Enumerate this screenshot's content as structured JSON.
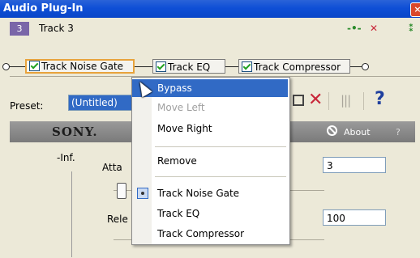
{
  "window": {
    "title": "Audio Plug-In",
    "close_label": "×"
  },
  "track": {
    "number": "3",
    "name": "Track 3"
  },
  "chain": {
    "plugins": [
      {
        "label": "Track Noise Gate",
        "checked": true,
        "active": true
      },
      {
        "label": "Track EQ",
        "checked": true,
        "active": false
      },
      {
        "label": "Track Compressor",
        "checked": true,
        "active": false
      }
    ]
  },
  "preset": {
    "label": "Preset:",
    "value": "(Untitled)"
  },
  "toolbar": {
    "delete_glyph": "✕",
    "bars_glyph": "|||",
    "help_glyph": "?"
  },
  "brand": {
    "logo": "SONY.",
    "about_label": "About",
    "help_label": "?"
  },
  "controls": {
    "inf_label": "-Inf.",
    "attack_label": "Atta",
    "release_label": "Rele",
    "attack_value": "3",
    "release_value": "100"
  },
  "context_menu": {
    "items": [
      {
        "label": "Bypass",
        "state": "highlighted"
      },
      {
        "label": "Move Left",
        "state": "disabled"
      },
      {
        "label": "Move Right",
        "state": "normal"
      },
      {
        "label": "Remove",
        "state": "normal"
      },
      {
        "label": "Track Noise Gate",
        "state": "selected"
      },
      {
        "label": "Track EQ",
        "state": "normal"
      },
      {
        "label": "Track Compressor",
        "state": "normal"
      }
    ]
  },
  "colors": {
    "title_bar": "#0f4fd6",
    "highlight": "#316ac5",
    "track_badge": "#7a66a8",
    "delete": "#c8273a"
  }
}
